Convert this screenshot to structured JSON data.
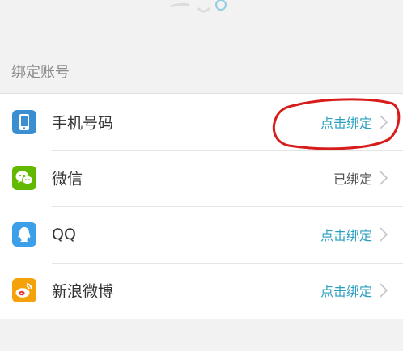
{
  "section": {
    "title": "绑定账号"
  },
  "accounts": [
    {
      "icon": "phone-icon",
      "label": "手机号码",
      "status": "点击绑定",
      "bound": false
    },
    {
      "icon": "wechat-icon",
      "label": "微信",
      "status": "已绑定",
      "bound": true
    },
    {
      "icon": "qq-icon",
      "label": "QQ",
      "status": "点击绑定",
      "bound": false
    },
    {
      "icon": "weibo-icon",
      "label": "新浪微博",
      "status": "点击绑定",
      "bound": false
    }
  ],
  "colors": {
    "link": "#2a9fc0",
    "bound_text": "#555555",
    "phone_icon": "#3a8fd3",
    "wechat_icon": "#62b900",
    "qq_icon": "#3ba0e9",
    "weibo_icon": "#f4a10a",
    "annotation": "#d81c1c"
  }
}
